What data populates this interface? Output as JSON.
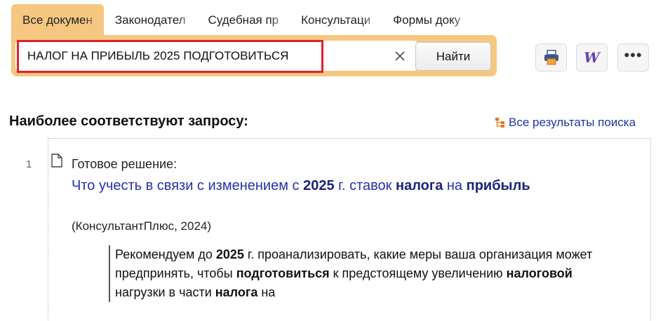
{
  "tabs": [
    {
      "label": "Все докумен",
      "active": true
    },
    {
      "label": "Законодател",
      "active": false
    },
    {
      "label": "Судебная пр",
      "active": false
    },
    {
      "label": "Консультаци",
      "active": false
    },
    {
      "label": "Формы доку",
      "active": false
    }
  ],
  "search": {
    "value": "НАЛОГ НА ПРИБЫЛЬ 2025 ПОДГОТОВИТЬСЯ",
    "find_label": "Найти"
  },
  "toolbar": {
    "print_icon": "printer-icon",
    "word_icon": "word-export-icon",
    "more_icon": "more-icon",
    "word_glyph": "W",
    "more_glyph": "•••"
  },
  "section_title": "Наиболее соответствуют запросу:",
  "all_results_label": "Все результаты поиска",
  "result": {
    "number": "1",
    "type": "Готовое решение:",
    "title_parts": [
      {
        "text": "Что учесть в связи с изменением с ",
        "bold": false
      },
      {
        "text": "2025",
        "bold": true
      },
      {
        "text": " г. ставок ",
        "bold": false
      },
      {
        "text": "налога",
        "bold": true
      },
      {
        "text": " на ",
        "bold": false
      },
      {
        "text": "прибыль",
        "bold": true
      }
    ],
    "source": "(КонсультантПлюс, 2024)",
    "snippet_parts": [
      {
        "text": "Рекомендуем до ",
        "bold": false
      },
      {
        "text": "2025",
        "bold": true
      },
      {
        "text": " г. проанализировать, какие меры ваша организация может предпринять, чтобы ",
        "bold": false
      },
      {
        "text": "подготовиться",
        "bold": true
      },
      {
        "text": " к предстоящему увеличению ",
        "bold": false
      },
      {
        "text": "налоговой",
        "bold": true
      },
      {
        "text": " нагрузки в части ",
        "bold": false
      },
      {
        "text": "налога",
        "bold": true
      },
      {
        "text": " на",
        "bold": false
      }
    ]
  },
  "colors": {
    "accent": "#f6c780",
    "highlight": "#e0202a",
    "link": "#2430b0"
  }
}
